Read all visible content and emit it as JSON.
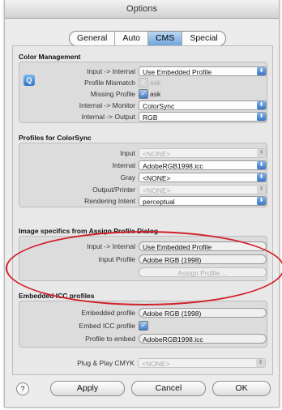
{
  "window": {
    "title": "Options"
  },
  "tabs": [
    {
      "label": "General"
    },
    {
      "label": "Auto"
    },
    {
      "label": "CMS"
    },
    {
      "label": "Special"
    }
  ],
  "color_management": {
    "title": "Color Management",
    "rows": [
      {
        "label": "Input -> Internal",
        "value": "Use Embedded Profile"
      },
      {
        "label": "Profile Mismatch",
        "check_label": "ask"
      },
      {
        "label": "Missing Profile",
        "check_label": "ask"
      },
      {
        "label": "Internal -> Monitor",
        "value": "ColorSync"
      },
      {
        "label": "Internal -> Output",
        "value": "RGB"
      }
    ]
  },
  "profiles_colorsync": {
    "title": "Profiles for ColorSync",
    "rows": [
      {
        "label": "Input",
        "value": "<NONE>"
      },
      {
        "label": "Internal",
        "value": "AdobeRGB1998.icc"
      },
      {
        "label": "Gray",
        "value": "<NONE>"
      },
      {
        "label": "Output/Printer",
        "value": "<NONE>"
      },
      {
        "label": "Rendering Intent",
        "value": "perceptual"
      }
    ]
  },
  "image_specifics": {
    "title": "Image specifics from Assign Profile Dialog",
    "rows": [
      {
        "label": "Input -> Internal",
        "value": "Use Embedded Profile"
      },
      {
        "label": "Input Profile",
        "value": "Adobe RGB (1998)"
      }
    ],
    "assign_button": "Assign Profile ..."
  },
  "embedded_icc": {
    "title": "Embedded ICC profiles",
    "rows": [
      {
        "label": "Embedded profile",
        "value": "Adobe RGB (1998)"
      },
      {
        "label": "Embed ICC profile"
      },
      {
        "label": "Profile to embed",
        "value": "AdobeRGB1998.icc"
      }
    ]
  },
  "plug_play": {
    "label": "Plug & Play CMYK",
    "value": "<NONE>"
  },
  "buttons": {
    "apply": "Apply",
    "cancel": "Cancel",
    "ok": "OK"
  },
  "icons": {
    "help": "?",
    "check": "✓",
    "popup_arrow": "⬍",
    "cms_info": "Q"
  },
  "colors": {
    "accent": "#3b77c6",
    "annotation_circle": "#d0202b"
  }
}
